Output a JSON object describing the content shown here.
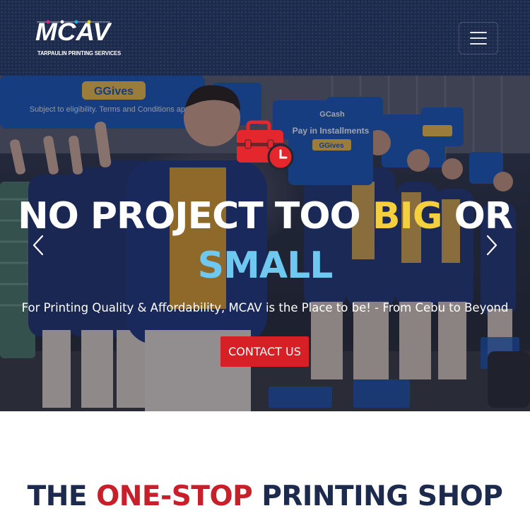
{
  "header": {
    "logo_text": "MCAV",
    "logo_tagline": "TARPAULIN PRINTING SERVICES",
    "menu_label": "Toggle navigation",
    "background": "#1c2a4d"
  },
  "hero": {
    "icon": "briefcase-clock-icon",
    "title_part1": "NO PROJECT TOO ",
    "title_highlight": "BIG",
    "title_part2": " OR",
    "title_line2": "SMALL",
    "subtitle": "For Printing Quality & Affordability, MCAV is the Place to be! - From Cebu to Beyond",
    "cta_label": "CONTACT US",
    "prev_icon": "chevron-left-icon",
    "next_icon": "chevron-right-icon",
    "colors": {
      "highlight": "#f4d03f",
      "line2": "#6ec8ef",
      "cta": "#d71f26"
    },
    "background_signs": {
      "main_sign": {
        "brand": "GGives",
        "text": "Subject to eligibility. Terms and Conditions apply."
      },
      "side_sign": {
        "brand": "GCash",
        "headline": "Pay in Installments",
        "sub_brand": "GGives"
      }
    }
  },
  "section": {
    "title_part1": "THE ",
    "title_accent": "ONE-STOP",
    "title_part2": " PRINTING SHOP",
    "colors": {
      "text": "#1c2a4d",
      "accent": "#c8202b"
    }
  }
}
